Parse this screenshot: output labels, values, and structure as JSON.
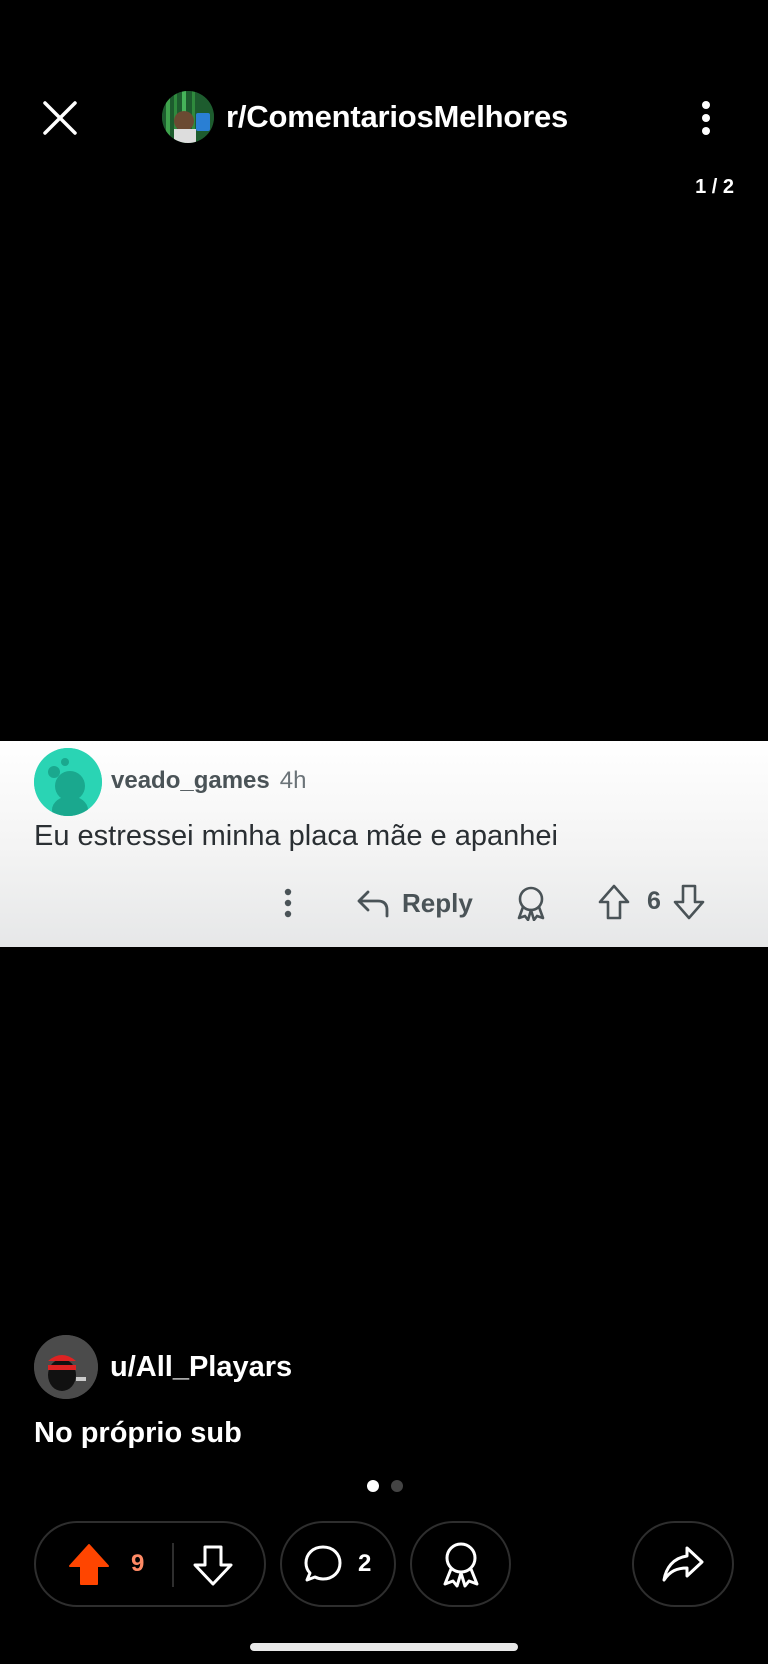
{
  "header": {
    "subreddit": "r/ComentariosMelhores",
    "page_indicator": "1 / 2"
  },
  "comment": {
    "username": "veado_games",
    "time": "4h",
    "text": "Eu estressei minha placa mãe e apanhei",
    "reply_label": "Reply",
    "score": "6"
  },
  "post": {
    "author": "u/All_Playars",
    "title": "No próprio sub",
    "upvotes": "9",
    "comments": "2",
    "image_pages": 2,
    "current_page": 1
  },
  "colors": {
    "upvote_active": "#ff4500",
    "upvote_count": "#ff8a65",
    "comment_avatar": "#2ad4b4"
  },
  "icons": [
    "close-icon",
    "more-vertical-icon",
    "reply-icon",
    "award-icon",
    "upvote-icon",
    "downvote-icon",
    "comment-icon",
    "share-icon"
  ]
}
